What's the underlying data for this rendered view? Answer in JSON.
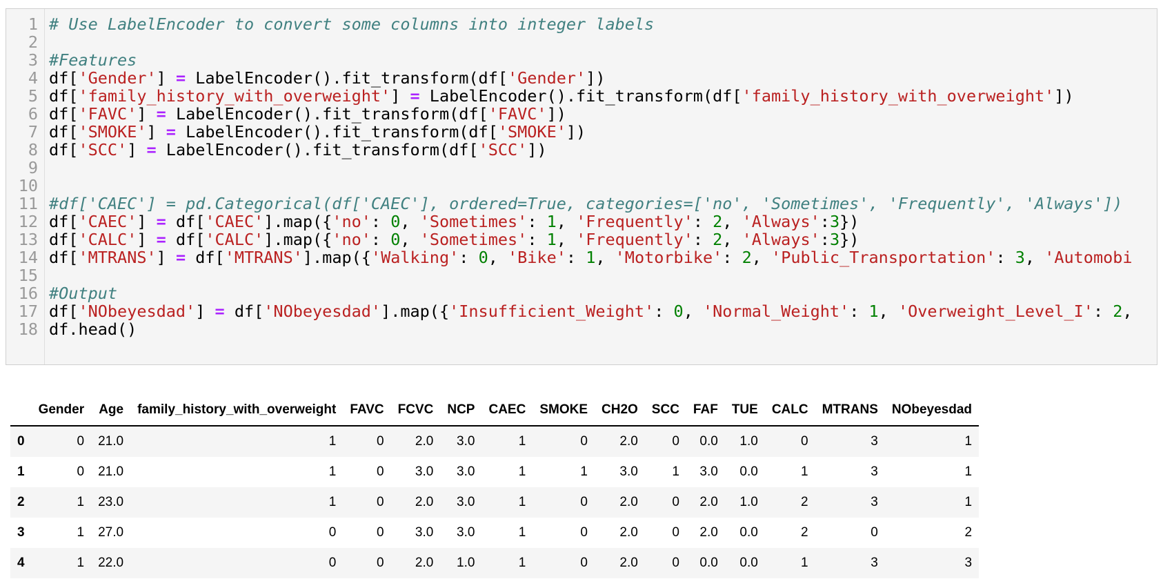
{
  "code_cell": {
    "lines": [
      {
        "no": "1",
        "tokens": [
          {
            "t": "# Use LabelEncoder to convert some columns into integer labels",
            "c": "comment"
          }
        ]
      },
      {
        "no": "2",
        "tokens": []
      },
      {
        "no": "3",
        "tokens": [
          {
            "t": "#Features",
            "c": "comment"
          }
        ]
      },
      {
        "no": "4",
        "tokens": [
          {
            "t": "df[",
            "c": ""
          },
          {
            "t": "'Gender'",
            "c": "str"
          },
          {
            "t": "] ",
            "c": ""
          },
          {
            "t": "=",
            "c": "op"
          },
          {
            "t": " LabelEncoder().fit_transform(df[",
            "c": ""
          },
          {
            "t": "'Gender'",
            "c": "str"
          },
          {
            "t": "])",
            "c": ""
          }
        ]
      },
      {
        "no": "5",
        "tokens": [
          {
            "t": "df[",
            "c": ""
          },
          {
            "t": "'family_history_with_overweight'",
            "c": "str"
          },
          {
            "t": "] ",
            "c": ""
          },
          {
            "t": "=",
            "c": "op"
          },
          {
            "t": " LabelEncoder().fit_transform(df[",
            "c": ""
          },
          {
            "t": "'family_history_with_overweight'",
            "c": "str"
          },
          {
            "t": "])",
            "c": ""
          }
        ]
      },
      {
        "no": "6",
        "tokens": [
          {
            "t": "df[",
            "c": ""
          },
          {
            "t": "'FAVC'",
            "c": "str"
          },
          {
            "t": "] ",
            "c": ""
          },
          {
            "t": "=",
            "c": "op"
          },
          {
            "t": " LabelEncoder().fit_transform(df[",
            "c": ""
          },
          {
            "t": "'FAVC'",
            "c": "str"
          },
          {
            "t": "])",
            "c": ""
          }
        ]
      },
      {
        "no": "7",
        "tokens": [
          {
            "t": "df[",
            "c": ""
          },
          {
            "t": "'SMOKE'",
            "c": "str"
          },
          {
            "t": "] ",
            "c": ""
          },
          {
            "t": "=",
            "c": "op"
          },
          {
            "t": " LabelEncoder().fit_transform(df[",
            "c": ""
          },
          {
            "t": "'SMOKE'",
            "c": "str"
          },
          {
            "t": "])",
            "c": ""
          }
        ]
      },
      {
        "no": "8",
        "tokens": [
          {
            "t": "df[",
            "c": ""
          },
          {
            "t": "'SCC'",
            "c": "str"
          },
          {
            "t": "] ",
            "c": ""
          },
          {
            "t": "=",
            "c": "op"
          },
          {
            "t": " LabelEncoder().fit_transform(df[",
            "c": ""
          },
          {
            "t": "'SCC'",
            "c": "str"
          },
          {
            "t": "])",
            "c": ""
          }
        ]
      },
      {
        "no": "9",
        "tokens": []
      },
      {
        "no": "10",
        "tokens": []
      },
      {
        "no": "11",
        "tokens": [
          {
            "t": "#df['CAEC'] = pd.Categorical(df['CAEC'], ordered=True, categories=['no', 'Sometimes', 'Frequently', 'Always'])",
            "c": "comment"
          }
        ]
      },
      {
        "no": "12",
        "tokens": [
          {
            "t": "df[",
            "c": ""
          },
          {
            "t": "'CAEC'",
            "c": "str"
          },
          {
            "t": "] ",
            "c": ""
          },
          {
            "t": "=",
            "c": "op"
          },
          {
            "t": " df[",
            "c": ""
          },
          {
            "t": "'CAEC'",
            "c": "str"
          },
          {
            "t": "].map({",
            "c": ""
          },
          {
            "t": "'no'",
            "c": "str"
          },
          {
            "t": ": ",
            "c": ""
          },
          {
            "t": "0",
            "c": "num"
          },
          {
            "t": ", ",
            "c": ""
          },
          {
            "t": "'Sometimes'",
            "c": "str"
          },
          {
            "t": ": ",
            "c": ""
          },
          {
            "t": "1",
            "c": "num"
          },
          {
            "t": ", ",
            "c": ""
          },
          {
            "t": "'Frequently'",
            "c": "str"
          },
          {
            "t": ": ",
            "c": ""
          },
          {
            "t": "2",
            "c": "num"
          },
          {
            "t": ", ",
            "c": ""
          },
          {
            "t": "'Always'",
            "c": "str"
          },
          {
            "t": ":",
            "c": ""
          },
          {
            "t": "3",
            "c": "num"
          },
          {
            "t": "})",
            "c": ""
          }
        ]
      },
      {
        "no": "13",
        "tokens": [
          {
            "t": "df[",
            "c": ""
          },
          {
            "t": "'CALC'",
            "c": "str"
          },
          {
            "t": "] ",
            "c": ""
          },
          {
            "t": "=",
            "c": "op"
          },
          {
            "t": " df[",
            "c": ""
          },
          {
            "t": "'CALC'",
            "c": "str"
          },
          {
            "t": "].map({",
            "c": ""
          },
          {
            "t": "'no'",
            "c": "str"
          },
          {
            "t": ": ",
            "c": ""
          },
          {
            "t": "0",
            "c": "num"
          },
          {
            "t": ", ",
            "c": ""
          },
          {
            "t": "'Sometimes'",
            "c": "str"
          },
          {
            "t": ": ",
            "c": ""
          },
          {
            "t": "1",
            "c": "num"
          },
          {
            "t": ", ",
            "c": ""
          },
          {
            "t": "'Frequently'",
            "c": "str"
          },
          {
            "t": ": ",
            "c": ""
          },
          {
            "t": "2",
            "c": "num"
          },
          {
            "t": ", ",
            "c": ""
          },
          {
            "t": "'Always'",
            "c": "str"
          },
          {
            "t": ":",
            "c": ""
          },
          {
            "t": "3",
            "c": "num"
          },
          {
            "t": "})",
            "c": ""
          }
        ]
      },
      {
        "no": "14",
        "tokens": [
          {
            "t": "df[",
            "c": ""
          },
          {
            "t": "'MTRANS'",
            "c": "str"
          },
          {
            "t": "] ",
            "c": ""
          },
          {
            "t": "=",
            "c": "op"
          },
          {
            "t": " df[",
            "c": ""
          },
          {
            "t": "'MTRANS'",
            "c": "str"
          },
          {
            "t": "].map({",
            "c": ""
          },
          {
            "t": "'Walking'",
            "c": "str"
          },
          {
            "t": ": ",
            "c": ""
          },
          {
            "t": "0",
            "c": "num"
          },
          {
            "t": ", ",
            "c": ""
          },
          {
            "t": "'Bike'",
            "c": "str"
          },
          {
            "t": ": ",
            "c": ""
          },
          {
            "t": "1",
            "c": "num"
          },
          {
            "t": ", ",
            "c": ""
          },
          {
            "t": "'Motorbike'",
            "c": "str"
          },
          {
            "t": ": ",
            "c": ""
          },
          {
            "t": "2",
            "c": "num"
          },
          {
            "t": ", ",
            "c": ""
          },
          {
            "t": "'Public_Transportation'",
            "c": "str"
          },
          {
            "t": ": ",
            "c": ""
          },
          {
            "t": "3",
            "c": "num"
          },
          {
            "t": ", ",
            "c": ""
          },
          {
            "t": "'Automobi",
            "c": "str"
          }
        ]
      },
      {
        "no": "15",
        "tokens": []
      },
      {
        "no": "16",
        "tokens": [
          {
            "t": "#Output",
            "c": "comment"
          }
        ]
      },
      {
        "no": "17",
        "tokens": [
          {
            "t": "df[",
            "c": ""
          },
          {
            "t": "'NObeyesdad'",
            "c": "str"
          },
          {
            "t": "] ",
            "c": ""
          },
          {
            "t": "=",
            "c": "op"
          },
          {
            "t": " df[",
            "c": ""
          },
          {
            "t": "'NObeyesdad'",
            "c": "str"
          },
          {
            "t": "].map({",
            "c": ""
          },
          {
            "t": "'Insufficient_Weight'",
            "c": "str"
          },
          {
            "t": ": ",
            "c": ""
          },
          {
            "t": "0",
            "c": "num"
          },
          {
            "t": ", ",
            "c": ""
          },
          {
            "t": "'Normal_Weight'",
            "c": "str"
          },
          {
            "t": ": ",
            "c": ""
          },
          {
            "t": "1",
            "c": "num"
          },
          {
            "t": ", ",
            "c": ""
          },
          {
            "t": "'Overweight_Level_I'",
            "c": "str"
          },
          {
            "t": ": ",
            "c": ""
          },
          {
            "t": "2",
            "c": "num"
          },
          {
            "t": ",",
            "c": ""
          }
        ]
      },
      {
        "no": "18",
        "tokens": [
          {
            "t": "df.head()",
            "c": ""
          }
        ]
      }
    ]
  },
  "output_table": {
    "columns": [
      "",
      "Gender",
      "Age",
      "family_history_with_overweight",
      "FAVC",
      "FCVC",
      "NCP",
      "CAEC",
      "SMOKE",
      "CH2O",
      "SCC",
      "FAF",
      "TUE",
      "CALC",
      "MTRANS",
      "NObeyesdad"
    ],
    "rows": [
      [
        "0",
        "0",
        "21.0",
        "1",
        "0",
        "2.0",
        "3.0",
        "1",
        "0",
        "2.0",
        "0",
        "0.0",
        "1.0",
        "0",
        "3",
        "1"
      ],
      [
        "1",
        "0",
        "21.0",
        "1",
        "0",
        "3.0",
        "3.0",
        "1",
        "1",
        "3.0",
        "1",
        "3.0",
        "0.0",
        "1",
        "3",
        "1"
      ],
      [
        "2",
        "1",
        "23.0",
        "1",
        "0",
        "2.0",
        "3.0",
        "1",
        "0",
        "2.0",
        "0",
        "2.0",
        "1.0",
        "2",
        "3",
        "1"
      ],
      [
        "3",
        "1",
        "27.0",
        "0",
        "0",
        "3.0",
        "3.0",
        "1",
        "0",
        "2.0",
        "0",
        "2.0",
        "0.0",
        "2",
        "0",
        "2"
      ],
      [
        "4",
        "1",
        "22.0",
        "0",
        "0",
        "2.0",
        "1.0",
        "1",
        "0",
        "2.0",
        "0",
        "0.0",
        "0.0",
        "1",
        "3",
        "3"
      ]
    ]
  }
}
